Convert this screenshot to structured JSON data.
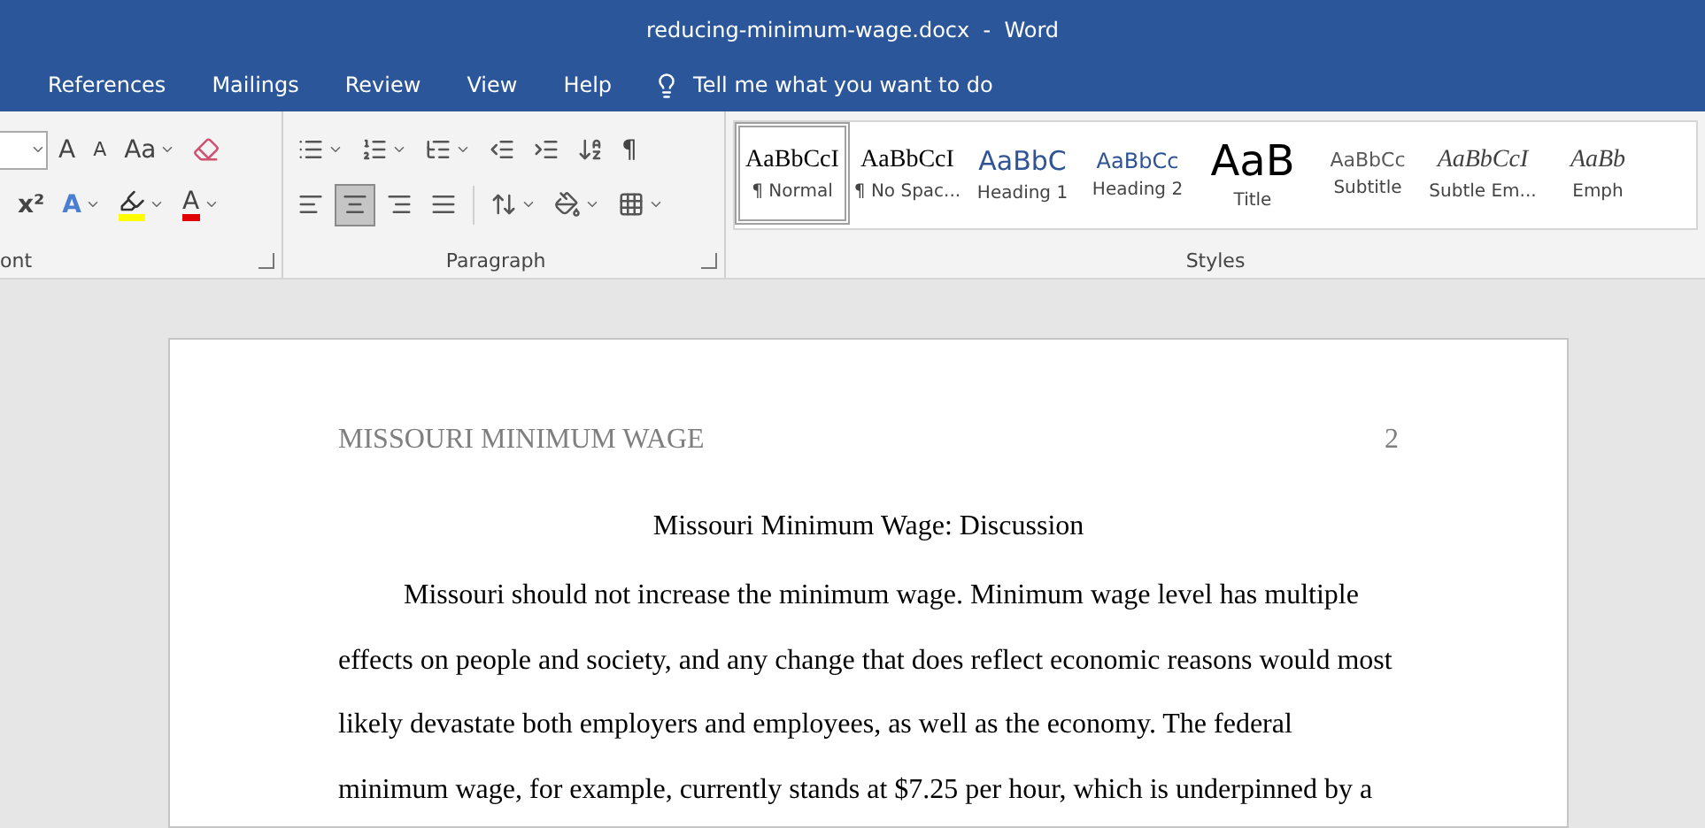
{
  "window": {
    "title": "reducing-minimum-wage.docx  -  Word"
  },
  "tabs": [
    {
      "label": "References"
    },
    {
      "label": "Mailings"
    },
    {
      "label": "Review"
    },
    {
      "label": "View"
    },
    {
      "label": "Help"
    }
  ],
  "tell_me": "Tell me what you want to do",
  "font_group": {
    "label": "ont",
    "row1": [
      {
        "kind": "dropdown"
      },
      {
        "kind": "grow",
        "text": "A"
      },
      {
        "kind": "shrink",
        "text": "A"
      },
      {
        "kind": "case",
        "text": "Aa"
      },
      {
        "kind": "eraser"
      }
    ],
    "row2": [
      {
        "kind": "superscript",
        "text": "x²"
      },
      {
        "kind": "effects",
        "text": "A"
      },
      {
        "kind": "highlight",
        "color": "#ffff00"
      },
      {
        "kind": "fontcolor",
        "text": "A",
        "color": "#e00000"
      }
    ]
  },
  "paragraph_group": {
    "label": "Paragraph",
    "row1": [
      {
        "kind": "bullets"
      },
      {
        "kind": "numbering"
      },
      {
        "kind": "multilevel"
      },
      {
        "kind": "outdent"
      },
      {
        "kind": "indent"
      },
      {
        "kind": "sort"
      },
      {
        "kind": "pilcrow",
        "text": "¶"
      }
    ],
    "alignment": [
      {
        "kind": "left",
        "selected": false
      },
      {
        "kind": "center",
        "selected": true
      },
      {
        "kind": "right",
        "selected": false
      },
      {
        "kind": "justify",
        "selected": false
      }
    ],
    "row2": [
      {
        "kind": "spacing"
      },
      {
        "kind": "shading"
      },
      {
        "kind": "borders"
      }
    ]
  },
  "styles_group": {
    "label": "Styles",
    "items": [
      {
        "preview": "AaBbCcI",
        "name": "¶ Normal",
        "kind": "serif",
        "selected": true
      },
      {
        "preview": "AaBbCcI",
        "name": "¶ No Spac...",
        "kind": "serif",
        "selected": false
      },
      {
        "preview": "AaBbC",
        "name": "Heading 1",
        "kind": "heading1",
        "selected": false
      },
      {
        "preview": "AaBbCc",
        "name": "Heading 2",
        "kind": "heading2",
        "selected": false
      },
      {
        "preview": "AaB",
        "name": "Title",
        "kind": "title",
        "selected": false
      },
      {
        "preview": "AaBbCc",
        "name": "Subtitle",
        "kind": "subtitle",
        "selected": false
      },
      {
        "preview": "AaBbCcI",
        "name": "Subtle Em...",
        "kind": "italic",
        "selected": false
      },
      {
        "preview": "AaBb",
        "name": "Emph",
        "kind": "italic",
        "selected": false
      }
    ]
  },
  "document": {
    "header": "MISSOURI MINIMUM WAGE",
    "page_number": "2",
    "title": "Missouri Minimum Wage: Discussion",
    "paragraph": "Missouri should not increase the minimum wage. Minimum wage level has multiple effects on people and society, and any change that does reflect economic reasons would most likely devastate both employers and employees, as well as the economy. The federal minimum wage, for example, currently stands at $7.25 per hour, which is underpinned by a"
  }
}
